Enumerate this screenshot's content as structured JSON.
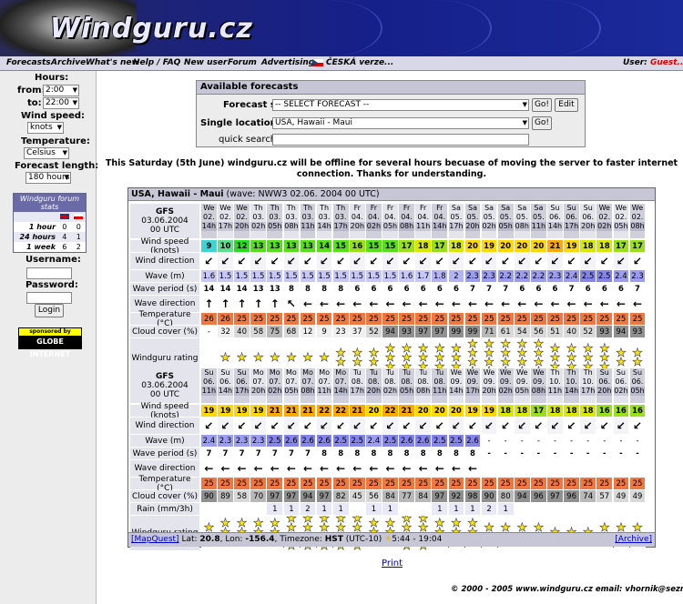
{
  "site": {
    "logo": "Windguru.cz"
  },
  "menu": {
    "items": [
      "Forecasts",
      "Archive",
      "What's new",
      "Help / FAQ",
      "New user",
      "Forum",
      "Advertising"
    ],
    "czech": "ČESKÁ verze...",
    "user_label": "User:",
    "user_value": "Guest..."
  },
  "sidebar": {
    "hours_label": "Hours:",
    "from_label": "from:",
    "from_value": "2:00",
    "to_label": "to:",
    "to_value": "22:00",
    "wind_label": "Wind speed:",
    "wind_value": "knots",
    "temp_label": "Temperature:",
    "temp_value": "Celsius",
    "length_label": "Forecast length:",
    "length_value": "180 hours",
    "stats": {
      "title": "Windguru forum stats",
      "rows": [
        {
          "label": "1 hour",
          "en": "0",
          "cz": "0"
        },
        {
          "label": "24 hours",
          "en": "4",
          "cz": "1"
        },
        {
          "label": "1 week",
          "en": "6",
          "cz": "2"
        }
      ]
    },
    "username_label": "Username:",
    "password_label": "Password:",
    "login": "Login",
    "sponsor_top": "sponsored by",
    "sponsor_name": "GLOBE INTERNET"
  },
  "available": {
    "title": "Available forecasts",
    "sets_label": "Forecast sets:",
    "sets_value": "-- SELECT FORECAST --",
    "go": "Go!",
    "edit": "Edit",
    "single_label": "Single locations:",
    "single_value": "USA, Hawaii - Maui",
    "search_label": "quick search:"
  },
  "notice": "This Saturday (5th June) windguru.cz will be offline for several hours becuase of moving the server to faster internet connection. Thanks for understanding.",
  "forecast": {
    "location": "USA, Hawaii - Maui",
    "wave_note": "(wave: NWW3 02.06. 2004 00 UTC)",
    "model": "GFS",
    "date": "03.06.2004",
    "run": "00 UTC",
    "labels": {
      "wind": "Wind speed (knots)",
      "dir": "Wind direction",
      "wave": "Wave (m)",
      "period": "Wave period (s)",
      "wavedir": "Wave direction",
      "temp": "Temperature (°C)",
      "cloud": "Cloud cover (%)",
      "rain": "Rain (mm/3h)",
      "rating": "Windguru rating"
    },
    "block1": {
      "days": [
        "We",
        "We",
        "We",
        "Th",
        "Th",
        "Th",
        "Th",
        "Th",
        "Th",
        "Fr",
        "Fr",
        "Fr",
        "Fr",
        "Fr",
        "Fr",
        "Sa",
        "Sa",
        "Sa",
        "Sa",
        "Sa",
        "Sa",
        "Su",
        "Su",
        "Su"
      ],
      "dates": [
        "02.",
        "02.",
        "02.",
        "03.",
        "03.",
        "03.",
        "03.",
        "03.",
        "03.",
        "04.",
        "04.",
        "04.",
        "04.",
        "04.",
        "04.",
        "05.",
        "05.",
        "05.",
        "05.",
        "05.",
        "05.",
        "06.",
        "06.",
        "06."
      ],
      "hours": [
        "14h",
        "17h",
        "20h",
        "02h",
        "05h",
        "08h",
        "11h",
        "14h",
        "17h",
        "02h",
        "05h",
        "08h",
        "11h",
        "14h",
        "17h",
        "20h",
        "02h",
        "05h",
        "08h",
        "11h",
        "14h",
        "17h",
        "20h",
        "02h"
      ],
      "hours2": [
        "14h",
        "17h",
        "20h",
        "02h",
        "05h",
        "08h",
        "11h",
        "14h",
        "17h",
        "20h",
        "02h",
        "05h",
        "08h",
        "11h",
        "14h",
        "17h",
        "20h",
        "02h",
        "05h",
        "08h",
        "11h",
        "14h",
        "17h",
        "20h",
        "02h",
        "05h",
        "08h"
      ],
      "wind": [
        "9",
        "10",
        "12",
        "13",
        "13",
        "13",
        "13",
        "14",
        "15",
        "16",
        "15",
        "15",
        "17",
        "18",
        "17",
        "18",
        "20",
        "19",
        "20",
        "20",
        "20",
        "21",
        "19",
        "18",
        "18",
        "17",
        "17"
      ],
      "wave": [
        "1.6",
        "1.5",
        "1.5",
        "1.5",
        "1.5",
        "1.5",
        "1.5",
        "1.5",
        "1.5",
        "1.5",
        "1.5",
        "1.5",
        "1.6",
        "1.7",
        "1.8",
        "2",
        "2.3",
        "2.3",
        "2.2",
        "2.2",
        "2.2",
        "2.3",
        "2.4",
        "2.5",
        "2.5",
        "2.4",
        "2.3"
      ],
      "period": [
        "14",
        "14",
        "14",
        "13",
        "13",
        "8",
        "8",
        "8",
        "8",
        "6",
        "6",
        "6",
        "6",
        "6",
        "6",
        "6",
        "7",
        "7",
        "7",
        "6",
        "6",
        "6",
        "7",
        "6",
        "6",
        "6",
        "7"
      ],
      "temp": [
        "26",
        "26",
        "25",
        "25",
        "25",
        "25",
        "25",
        "25",
        "25",
        "25",
        "25",
        "25",
        "25",
        "25",
        "25",
        "25",
        "25",
        "25",
        "25",
        "25",
        "25",
        "25",
        "25",
        "25",
        "25",
        "25",
        "25"
      ],
      "cloud": [
        "-",
        "32",
        "40",
        "58",
        "75",
        "68",
        "12",
        "9",
        "23",
        "37",
        "52",
        "94",
        "93",
        "97",
        "97",
        "99",
        "99",
        "71",
        "61",
        "54",
        "56",
        "51",
        "40",
        "52",
        "93",
        "94",
        "93"
      ],
      "stars": [
        0,
        1,
        1,
        1,
        1,
        1,
        1,
        1,
        2,
        2,
        2,
        3,
        3,
        3,
        3,
        3,
        4,
        4,
        4,
        4,
        4,
        3,
        3,
        3,
        3,
        2,
        2
      ]
    },
    "block2": {
      "days": [
        "Su",
        "Su",
        "Su",
        "Mo",
        "Mo",
        "Mo",
        "Mo",
        "Mo",
        "Mo",
        "Tu",
        "Tu",
        "Tu",
        "Tu",
        "Tu",
        "Tu",
        "We",
        "We",
        "We",
        "We",
        "We",
        "We",
        "Th",
        "Th",
        "Th"
      ],
      "dates": [
        "06.",
        "06.",
        "06.",
        "07.",
        "07.",
        "07.",
        "07.",
        "07.",
        "07.",
        "08.",
        "08.",
        "08.",
        "08.",
        "08.",
        "08.",
        "09.",
        "09.",
        "09.",
        "09.",
        "09.",
        "09.",
        "10.",
        "10.",
        "10."
      ],
      "hours": [
        "11h",
        "14h",
        "17h",
        "20h",
        "02h",
        "05h",
        "08h",
        "11h",
        "14h",
        "17h",
        "20h",
        "02h",
        "05h",
        "08h",
        "11h",
        "14h",
        "17h",
        "20h",
        "02h",
        "05h",
        "08h",
        "11h",
        "14h",
        "17h",
        "20h",
        "02h",
        "05h"
      ],
      "wind": [
        "19",
        "19",
        "19",
        "19",
        "21",
        "21",
        "21",
        "22",
        "22",
        "21",
        "20",
        "22",
        "21",
        "20",
        "20",
        "20",
        "19",
        "19",
        "18",
        "18",
        "17",
        "18",
        "18",
        "18",
        "16",
        "16",
        "16"
      ],
      "wave": [
        "2.4",
        "2.3",
        "2.3",
        "2.3",
        "2.5",
        "2.6",
        "2.6",
        "2.6",
        "2.5",
        "2.5",
        "2.4",
        "2.5",
        "2.6",
        "2.6",
        "2.5",
        "2.5",
        "2.6",
        "-",
        "-",
        "-",
        "-",
        "-",
        "-",
        "-",
        "-",
        "-",
        "-"
      ],
      "period": [
        "7",
        "7",
        "7",
        "7",
        "7",
        "7",
        "7",
        "8",
        "8",
        "8",
        "8",
        "8",
        "8",
        "8",
        "8",
        "8",
        "8",
        "-",
        "-",
        "-",
        "-",
        "-",
        "-",
        "-",
        "-",
        "-",
        "-"
      ],
      "temp": [
        "25",
        "25",
        "25",
        "25",
        "25",
        "25",
        "25",
        "25",
        "25",
        "25",
        "25",
        "25",
        "25",
        "25",
        "25",
        "25",
        "25",
        "25",
        "25",
        "25",
        "25",
        "25",
        "25",
        "25",
        "25",
        "25",
        "25"
      ],
      "cloud": [
        "90",
        "89",
        "58",
        "70",
        "97",
        "97",
        "94",
        "97",
        "82",
        "45",
        "56",
        "84",
        "77",
        "84",
        "97",
        "92",
        "98",
        "90",
        "80",
        "94",
        "96",
        "97",
        "96",
        "74",
        "57",
        "49",
        "49"
      ],
      "rain": [
        "",
        "",
        "",
        "",
        "1",
        "1",
        "2",
        "1",
        "1",
        "",
        "1",
        "1",
        "",
        "",
        "1",
        "1",
        "1",
        "2",
        "1",
        "",
        "",
        "",
        "",
        "",
        "",
        "",
        ""
      ],
      "stars": [
        2,
        3,
        3,
        3,
        3,
        4,
        4,
        4,
        4,
        4,
        3,
        3,
        4,
        4,
        3,
        3,
        3,
        2,
        2,
        2,
        2,
        1,
        1,
        1,
        2,
        2,
        2
      ]
    },
    "footer": {
      "mapquest": "[MapQuest]",
      "lat_label": "Lat:",
      "lat": "20.8",
      "lon_label": "Lon:",
      "lon": "-156.4",
      "tz_label": "Timezone:",
      "tz": "HST",
      "tz_note": "(UTC-10)",
      "sun": "5:44 - 19:04",
      "archive": "[Archive]"
    }
  },
  "print": "Print",
  "copyright": "© 2000 - 2005 www.windguru.cz     email: vhornik@seznam.cz"
}
